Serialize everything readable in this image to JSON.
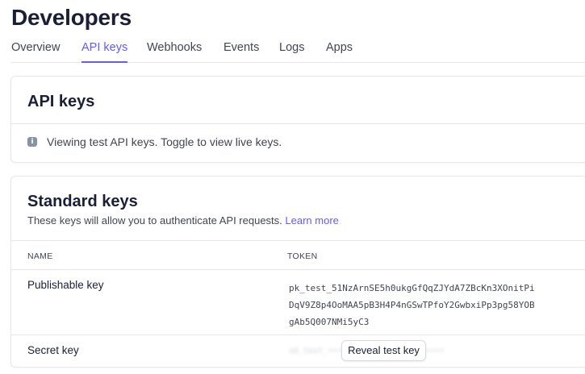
{
  "page": {
    "title": "Developers"
  },
  "tabs": [
    {
      "label": "Overview",
      "active": false
    },
    {
      "label": "API keys",
      "active": true
    },
    {
      "label": "Webhooks",
      "active": false
    },
    {
      "label": "Events",
      "active": false
    },
    {
      "label": "Logs",
      "active": false
    },
    {
      "label": "Apps",
      "active": false
    }
  ],
  "api_keys_card": {
    "title": "API keys",
    "info_icon": "info-icon",
    "info_text": "Viewing test API keys. Toggle to view live keys."
  },
  "standard_keys_card": {
    "title": "Standard keys",
    "description": "These keys will allow you to authenticate API requests.",
    "learn_more": "Learn more",
    "columns": {
      "name": "NAME",
      "token": "TOKEN"
    },
    "rows": [
      {
        "name": "Publishable key",
        "token_lines": [
          "pk_test_51NzArnSE5h0ukgGfQqZJYdA7ZBcKn3XOnitPi",
          "DqV9Z8p4OoMAA5pB3H4P4nGSwTPfoY2GwbxiPp3pg58YOB",
          "gAb5Q007NMi5yC3"
        ]
      },
      {
        "name": "Secret key",
        "reveal_button": "Reveal test key"
      }
    ]
  },
  "colors": {
    "accent": "#635bff",
    "text": "#1a1f36",
    "muted": "#414552",
    "border": "#e3e8ee"
  }
}
